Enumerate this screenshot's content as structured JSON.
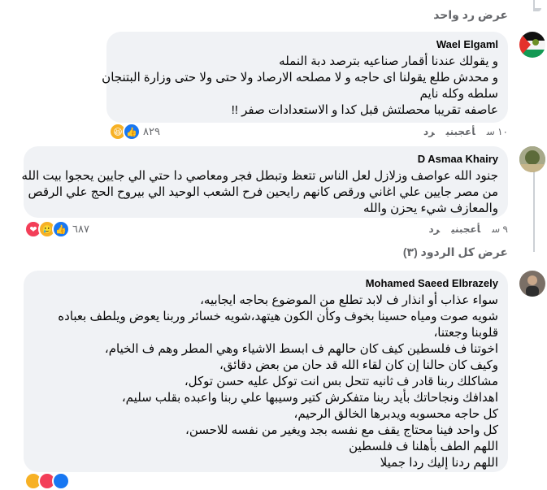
{
  "top_link": "عرض رد واحد",
  "comments": [
    {
      "author": "Wael Elgaml",
      "lines": [
        "و يقولك عندنا أقمار صناعيه بترصد دبة النمله",
        "و محدش طلع يقولنا اى حاجه و لا مصلحه الارصاد ولا حتى ولا حتى وزارة البتنجان",
        "سلطه وكله نايم",
        "عاصفه تقريبا محصلتش قبل كدا و الاستعدادات صفر !!"
      ],
      "time": "١٠ س",
      "like": "أعجبني",
      "reply": "رد",
      "reaction_count": "٨٢٩",
      "reactions": [
        "haha",
        "like"
      ]
    },
    {
      "author": "D Asmaa Khairy",
      "lines": [
        "جنود الله عواصف وزلازل لعل الناس تتعظ وتبطل فجر ومعاصي دا حتي الي جايين يحجوا بيت الله",
        "من مصر جايين علي اغاني ورقص كانهم رايحين فرح الشعب الوحيد الي بيروح الحج علي الرقص",
        "والمعازف شيء يحزن والله"
      ],
      "time": "٩ س",
      "like": "أعجبني",
      "reply": "رد",
      "reaction_count": "٦٨٧",
      "reactions": [
        "love",
        "care",
        "like"
      ]
    },
    {
      "author": "Mohamed Saeed Elbrazely",
      "lines": [
        "سواء عذاب أو انذار ف لابد تطلع من الموضوع بحاجه ايجابيه،",
        "شويه صوت ومياه حسينا بخوف وكأن الكون هيتهد،شويه خسائر وربنا يعوض ويلطف بعباده",
        "قلوبنا وجعتنا،",
        "اخوتنا ف فلسطين كيف كان حالهم ف ابسط الاشياء وهي المطر وهم ف الخيام،",
        "وكيف كان حالنا إن كان لقاء الله قد حان من بعض دقائق،",
        "مشاكلك ربنا قادر ف ثانيه تتحل بس انت توكل عليه حسن توكل،",
        "اهدافك ونجاحاتك بأيد ربنا متفكرش كتير وسيبها علي ربنا واعبده بقلب سليم،",
        "كل حاجه محسوبه ويدبرها الخالق الرحيم،",
        "كل واحد فينا محتاج يقف مع نفسه بجد ويغير من نفسه للاحسن،",
        "اللهم الطف بأهلنا ف فلسطين",
        "اللهم ردنا إليك ردا جميلا"
      ]
    }
  ],
  "view_all_replies": "عرض كل الردود (٣)",
  "colors": {
    "bubble": "#f0f2f5",
    "like": "#1877f2",
    "love": "#f33e58",
    "haha": "#f7b125"
  }
}
